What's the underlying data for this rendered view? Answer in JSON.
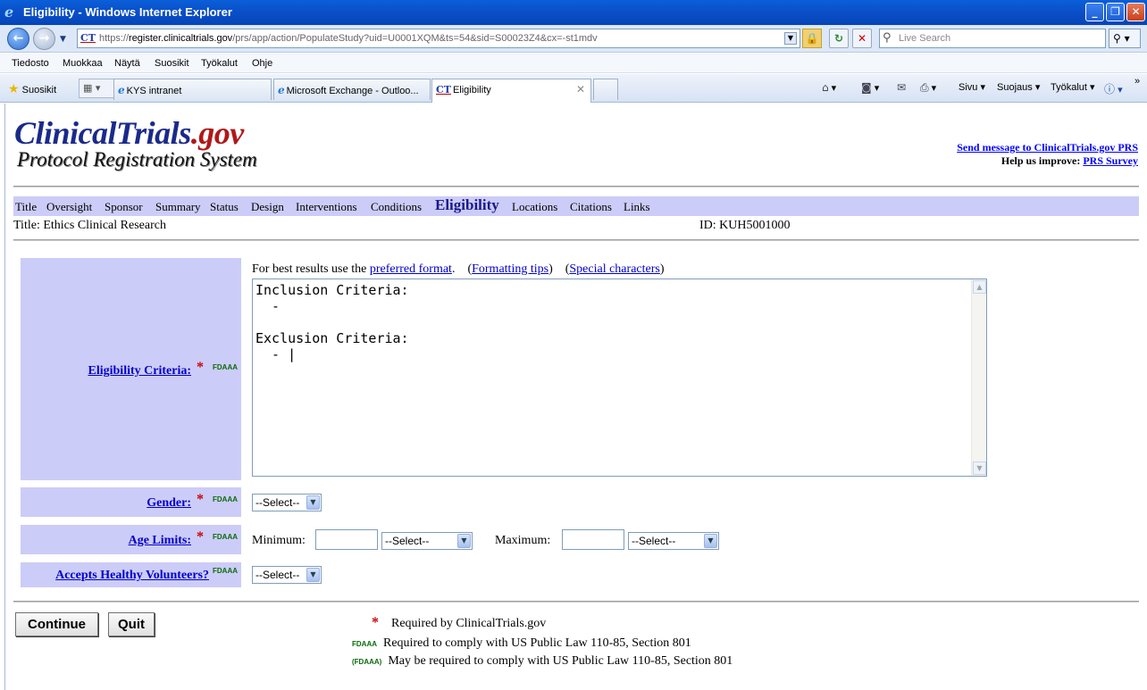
{
  "window": {
    "title": "Eligibility - Windows Internet Explorer"
  },
  "address_bar": {
    "url_prefix": "https://",
    "url_domain": "register.clinicaltrials.gov",
    "url_path": "/prs/app/action/PopulateStudy?uid=U0001XQM&ts=54&sid=S00023Z4&cx=-st1mdv",
    "search_placeholder": "Live Search",
    "site_icon": "CT"
  },
  "menu": [
    "Tiedosto",
    "Muokkaa",
    "Näytä",
    "Suosikit",
    "Työkalut",
    "Ohje"
  ],
  "favorites_label": "Suosikit",
  "tabs": [
    {
      "label": "KYS intranet"
    },
    {
      "label": "Microsoft Exchange - Outloo..."
    },
    {
      "label": "Eligibility"
    }
  ],
  "command_bar": {
    "page": "Sivu",
    "security": "Suojaus",
    "tools": "Työkalut"
  },
  "site": {
    "logo_main": "ClinicalTrials",
    "logo_tld": ".gov",
    "logo_sub": "Protocol Registration System",
    "send_message_link": "Send message to ClinicalTrials.gov PRS",
    "help_prefix": "Help us improve:",
    "survey_link": "PRS Survey"
  },
  "nav": [
    "Title",
    "Oversight",
    "Sponsor",
    "Summary",
    "Status",
    "Design",
    "Interventions",
    "Conditions",
    "Eligibility",
    "Locations",
    "Citations",
    "Links"
  ],
  "record": {
    "title_label": "Title: Ethics Clinical Research",
    "id_label": "ID: KUH5001000"
  },
  "form": {
    "tips_prefix": "For best results use the",
    "preferred_format": "preferred format",
    "formatting_tips": "Formatting tips",
    "special_chars": "Special characters",
    "eligibility_label": "Eligibility Criteria:",
    "criteria_text": "Inclusion Criteria:\n  -\n\nExclusion Criteria:\n  - |",
    "gender_label": "Gender:",
    "gender_value": "--Select--",
    "age_label": "Age Limits:",
    "min_label": "Minimum:",
    "min_unit": "--Select--",
    "max_label": "Maximum:",
    "max_unit": "--Select--",
    "healthy_label": "Accepts Healthy Volunteers?",
    "healthy_value": "--Select--",
    "fdaaa": "FDAAA",
    "req_star": "*"
  },
  "buttons": {
    "continue": "Continue",
    "quit": "Quit"
  },
  "legend": {
    "star_text": "Required by ClinicalTrials.gov",
    "fdaaa_tag": "FDAAA",
    "fdaaa_text": "Required to comply with US Public Law 110-85, Section 801",
    "fdaaa_paren_tag": "(FDAAA)",
    "fdaaa_paren_text": "May be required to comply with US Public Law 110-85, Section 801"
  }
}
